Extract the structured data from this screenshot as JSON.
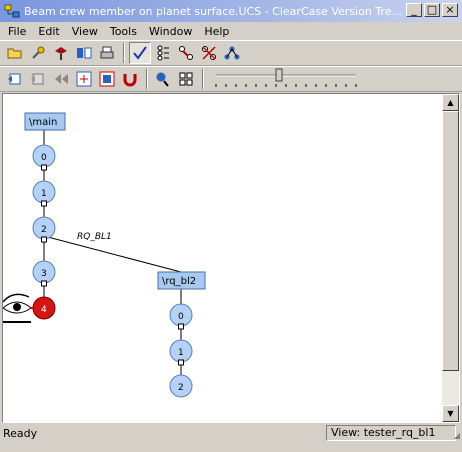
{
  "window": {
    "title": "Beam crew member on planet surface.UCS - ClearCase Version Tre...",
    "controls": [
      "_",
      "□",
      "×"
    ]
  },
  "menu": [
    "File",
    "Edit",
    "View",
    "Tools",
    "Window",
    "Help"
  ],
  "toolbar1": {
    "icons": [
      "open-folder-icon",
      "properties-icon",
      "version-info-icon",
      "compare-icon",
      "print-icon",
      "show-all-versions-icon",
      "show-labels-icon",
      "merge-arrows-icon",
      "hide-merges-icon",
      "tree-layout-icon"
    ],
    "pressed": [
      "show-all-versions-icon"
    ]
  },
  "toolbar2": {
    "icons": [
      "refresh-icon",
      "expand-icon",
      "collapse-icon",
      "zoom-fit-icon",
      "zoom-box-icon",
      "magnet-icon",
      "locate-icon",
      "view-list-icon"
    ],
    "zoom_slider": 0.45
  },
  "tree": {
    "main_branch": "\\main",
    "main_versions": [
      "0",
      "1",
      "2",
      "3",
      "4"
    ],
    "current_version": "4",
    "merge_label": "RQ_BL1",
    "sub_branch": "\\rq_bl2",
    "sub_versions": [
      "0",
      "1",
      "2"
    ]
  },
  "colors": {
    "node_fill": "#b4d2f5",
    "node_stroke": "#5a7ec2",
    "current_fill": "#d51414",
    "branch_fill": "#a7c8ef"
  },
  "status": {
    "left": "Ready",
    "view": "View:  tester_rq_bl1"
  }
}
